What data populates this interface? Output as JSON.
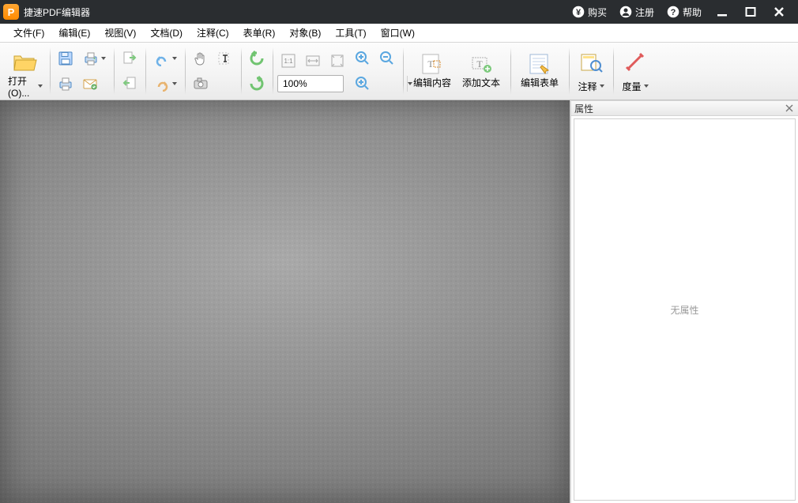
{
  "app": {
    "title": "捷速PDF编辑器"
  },
  "titlebar_actions": {
    "buy": "购买",
    "register": "注册",
    "help": "帮助"
  },
  "menu": {
    "file": "文件(F)",
    "edit": "编辑(E)",
    "view": "视图(V)",
    "doc": "文档(D)",
    "comment": "注释(C)",
    "form": "表单(R)",
    "object": "对象(B)",
    "tool": "工具(T)",
    "window": "窗口(W)"
  },
  "toolbar": {
    "open": "打开(O)...",
    "zoom_value": "100%",
    "edit_content": "编辑内容",
    "add_text": "添加文本",
    "edit_form": "编辑表单",
    "annotate": "注释",
    "measure": "度量"
  },
  "props_panel": {
    "title": "属性",
    "empty": "无属性"
  }
}
